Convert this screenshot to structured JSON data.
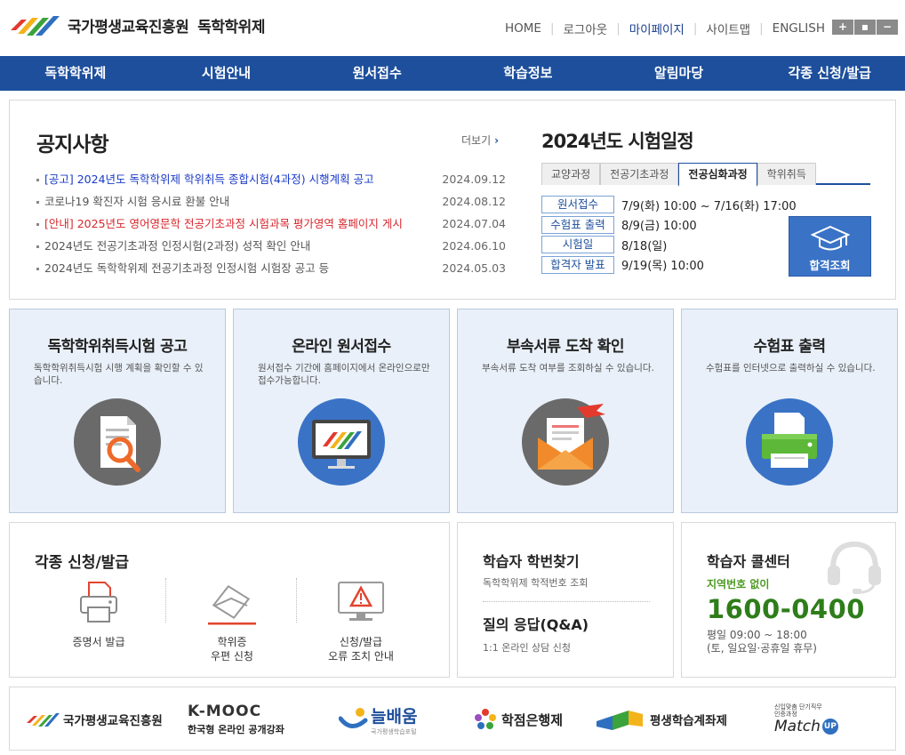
{
  "header": {
    "org_name": "국가평생교육진흥원",
    "site_name": "독학학위제",
    "util_links": [
      "HOME",
      "로그아웃",
      "마이페이지",
      "사이트맵",
      "ENGLISH"
    ],
    "font_buttons": [
      "+",
      "▪",
      "−"
    ]
  },
  "gnb": [
    "독학학위제",
    "시험안내",
    "원서접수",
    "학습정보",
    "알림마당",
    "각종 신청/발급"
  ],
  "notice": {
    "title": "공지사항",
    "more": "더보기",
    "items": [
      {
        "text": "[공고] 2024년도 독학학위제 학위취득 종합시험(4과정) 시행계획 공고",
        "date": "2024.09.12"
      },
      {
        "text": "코로나19 확진자 시험 응시료 환불 안내",
        "date": "2024.08.12"
      },
      {
        "text": "[안내] 2025년도 영어영문학 전공기초과정 시험과목 평가영역 홈페이지 게시",
        "date": "2024.07.04"
      },
      {
        "text": "2024년도 전공기초과정 인정시험(2과정) 성적 확인 안내",
        "date": "2024.06.10"
      },
      {
        "text": "2024년도 독학학위제 전공기초과정 인정시험 시험장 공고 등",
        "date": "2024.05.03"
      }
    ]
  },
  "schedule": {
    "title": "2024년도 시험일정",
    "tabs": [
      "교양과정",
      "전공기초과정",
      "전공심화과정",
      "학위취득"
    ],
    "rows": [
      {
        "key": "원서접수",
        "val": "7/9(화) 10:00 ~ 7/16(화) 17:00"
      },
      {
        "key": "수험표 출력",
        "val": "8/9(금) 10:00"
      },
      {
        "key": "시험일",
        "val": "8/18(일)"
      },
      {
        "key": "합격자 발표",
        "val": "9/19(목) 10:00"
      }
    ],
    "pass_button": "합격조회"
  },
  "cards": [
    {
      "title": "독학학위취득시험 공고",
      "desc": "독학학위취득시험 시행 계획을 확인할 수 있습니다."
    },
    {
      "title": "온라인 원서접수",
      "desc": "원서접수 기간에 홈페이지에서 온라인으로만 접수가능합니다."
    },
    {
      "title": "부속서류 도착 확인",
      "desc": "부속서류 도착 여부를 조회하실 수 있습니다."
    },
    {
      "title": "수험표 출력",
      "desc": "수험표를 인터넷으로 출력하실 수 있습니다."
    }
  ],
  "apply": {
    "title": "각종 신청/발급",
    "items": [
      "증명서 발급",
      "학위증\n우편 신청",
      "신청/발급\n오류 조치 안내"
    ]
  },
  "find": {
    "title1": "학습자 학번찾기",
    "sub1": "독학학위제 학적번호 조회",
    "title2": "질의 응답(Q&A)",
    "sub2": "1:1 온라인 상담 신청"
  },
  "call": {
    "title": "학습자 콜센터",
    "sub": "지역번호 없이",
    "number": "1600-0400",
    "hours1": "평일 09:00 ~ 18:00",
    "hours2": "(토, 일요일·공휴일 휴무)"
  },
  "banners": {
    "nile": "국가평생교육진흥원",
    "kmooc": "K-MOOC",
    "kmooc_sub": "한국형 온라인 공개강좌",
    "neul": "늘배움",
    "neul_sub": "국가평생학습포털",
    "cb": "학점은행제",
    "ll": "평생학습계좌제",
    "match": "Match",
    "match_sub": "신입맞춤 단기직무인증과정",
    "match_up": "UP"
  },
  "colors": {
    "primary": "#1d4f9c",
    "notice_blue": "#1a3ac8",
    "notice_red": "#d8262c",
    "call_green": "#2e7d1a"
  }
}
